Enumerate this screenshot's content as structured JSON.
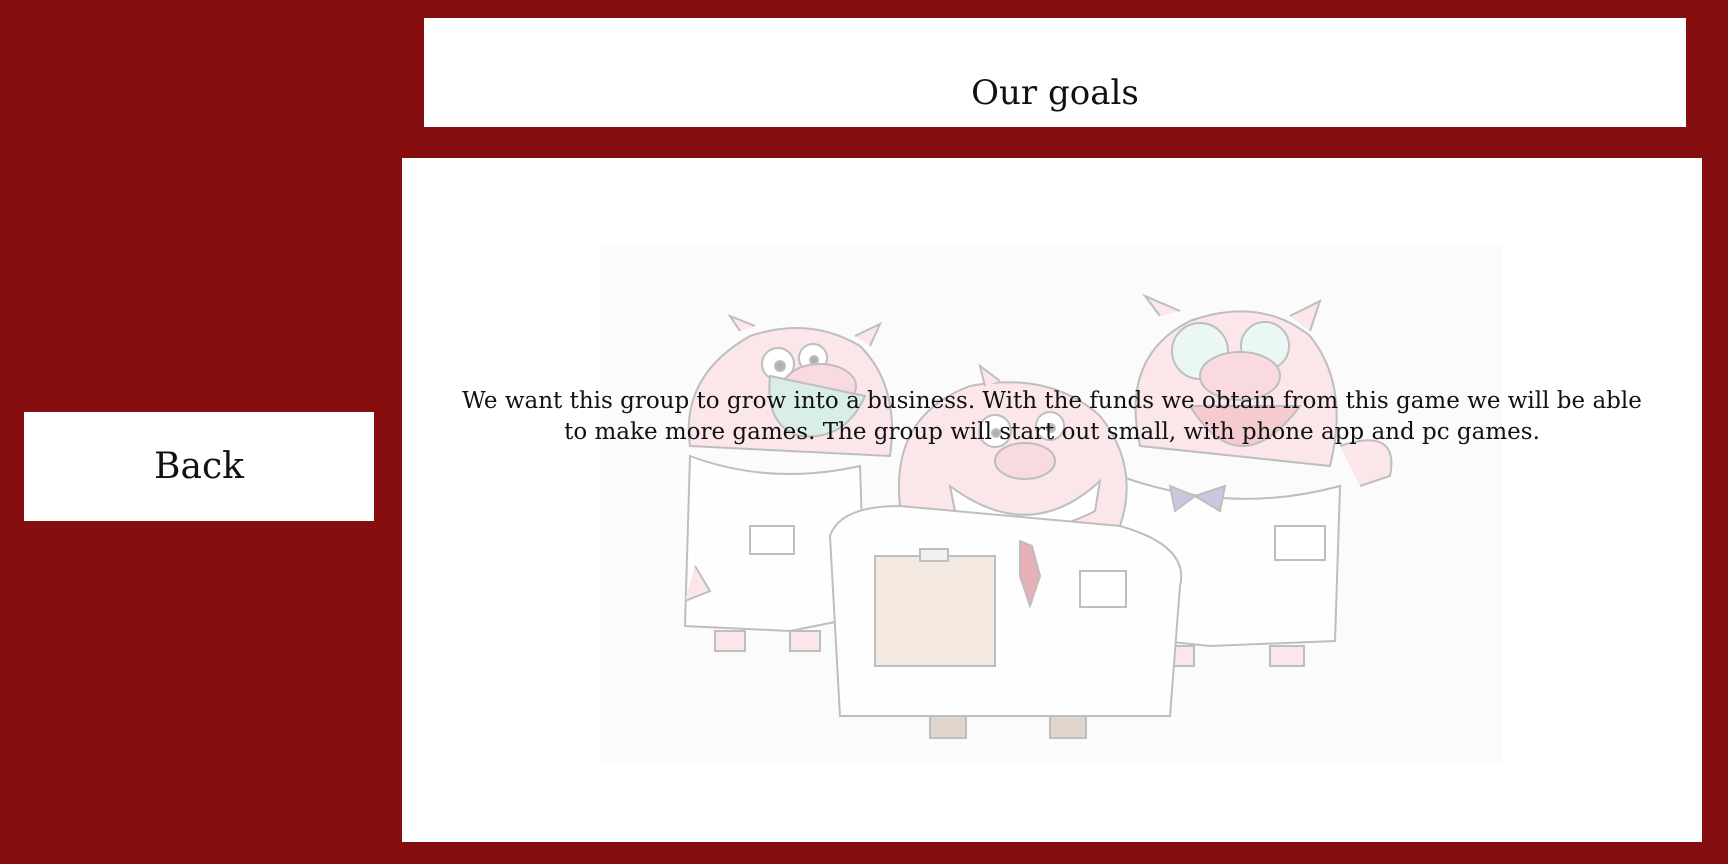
{
  "header": {
    "title": "Our goals"
  },
  "nav": {
    "back_label": "Back"
  },
  "main": {
    "goals_text": "We want this group to grow into a business.  With the funds we obtain from this game we will be able to make more games. The group will start out small, with phone app and pc games.",
    "illustration_icon": "three-pig-scientists-illustration"
  },
  "colors": {
    "background": "#870e0e",
    "panel": "#ffffff",
    "text": "#111111"
  }
}
